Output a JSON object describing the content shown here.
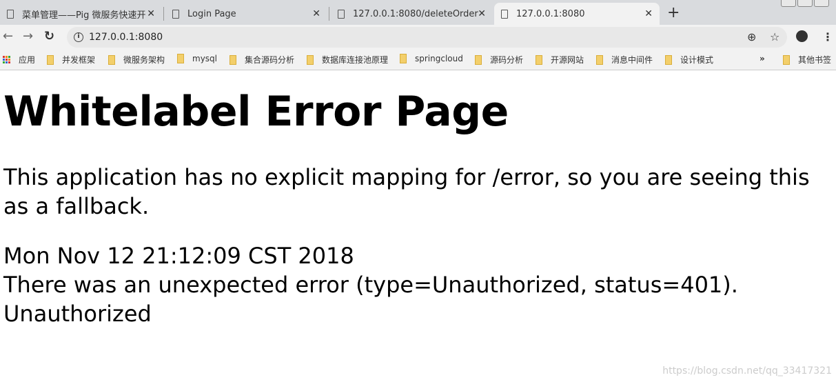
{
  "tabs": [
    {
      "title": "菜单管理——Pig 微服务快速开发",
      "active": false
    },
    {
      "title": "Login Page",
      "active": false
    },
    {
      "title": "127.0.0.1:8080/deleteOrder",
      "active": false
    },
    {
      "title": "127.0.0.1:8080",
      "active": true
    }
  ],
  "new_tab": "+",
  "address": {
    "url": "127.0.0.1:8080"
  },
  "bookmarks": {
    "apps": "应用",
    "items": [
      "并发框架",
      "微服务架构",
      "mysql",
      "集合源码分析",
      "数据库连接池原理",
      "springcloud",
      "源码分析",
      "开源网站",
      "消息中间件",
      "设计模式"
    ],
    "overflow": "»",
    "other": "其他书签"
  },
  "page": {
    "heading": "Whitelabel Error Page",
    "message": "This application has no explicit mapping for /error, so you are seeing this as a fallback.",
    "timestamp": "Mon Nov 12 21:12:09 CST 2018",
    "error": "There was an unexpected error (type=Unauthorized, status=401).",
    "detail": "Unauthorized"
  },
  "watermark": "https://blog.csdn.net/qq_33417321"
}
